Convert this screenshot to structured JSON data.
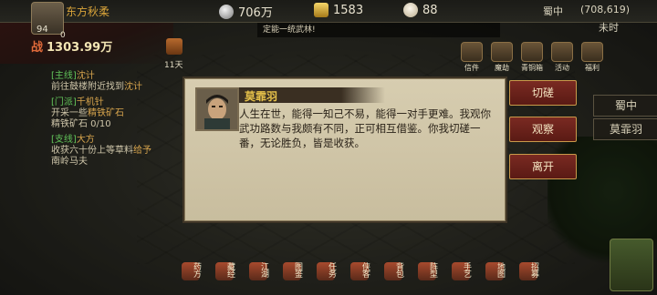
{
  "player": {
    "name": "东方秋柔",
    "stat_a": "94",
    "stat_b": "0",
    "power_label": "战",
    "power": "1303.99万"
  },
  "resources": [
    {
      "icon": "silver-coin-icon",
      "value": "706万",
      "color": "#c9c9c9"
    },
    {
      "icon": "gold-ingot-icon",
      "value": "1583",
      "color": "#e2b84a"
    },
    {
      "icon": "bun-icon",
      "value": "88",
      "color": "#e8e0d0"
    }
  ],
  "location": {
    "region": "蜀中",
    "coords": "(708,619)",
    "hour": "未时"
  },
  "notice": "定能一统武林!",
  "days": "11天",
  "quests": [
    {
      "tag": "[主线]",
      "name": "沈计",
      "line1": "前往鼓楼附近找到",
      "highlight1": "沈计",
      "line2": ""
    },
    {
      "tag": "[门派]",
      "name": "千机针",
      "line1": "开采一些",
      "highlight1": "精铁矿石",
      "line2": "精铁矿石 0/10"
    },
    {
      "tag": "[支线]",
      "name": "大方",
      "line1": "收获六十份上等草料",
      "highlight1": "给予",
      "line2": "南岭马夫"
    }
  ],
  "side_icons": [
    "信件",
    "魔劫",
    "青铜箱",
    "活动",
    "福利"
  ],
  "right_panel": [
    "蜀中",
    "莫霏羽"
  ],
  "dialog": {
    "speaker": "莫霏羽",
    "text": "人生在世，能得一知己不易，能得一对手更难。我观你武功路数与我颇有不同，正可相互借鉴。你我切磋一番，无论胜负，皆是收获。"
  },
  "options": [
    "切磋",
    "观察",
    "离开"
  ],
  "bottom_menu": [
    "药方",
    "藏经",
    "江湖",
    "图鉴",
    "任务",
    "侠客",
    "背包",
    "阵型",
    "手艺",
    "地图",
    "招募"
  ]
}
